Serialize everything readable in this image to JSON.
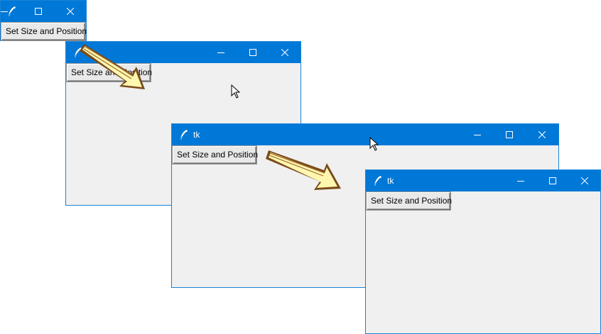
{
  "windows": [
    {
      "title": "",
      "button_label": "Set Size and Position"
    },
    {
      "title": "",
      "button_label": "Set Size and Position"
    },
    {
      "title": "tk",
      "button_label": "Set Size and Position"
    },
    {
      "title": "tk",
      "button_label": "Set Size and Position"
    }
  ],
  "icons": {
    "app": "feather-icon",
    "minimize": "minimize-icon",
    "maximize": "maximize-icon",
    "close": "close-icon",
    "cursor": "mouse-cursor-icon",
    "transition": "arrow-icon"
  },
  "colors": {
    "titlebar": "#0078d7",
    "window_bg": "#f0f0f0",
    "arrow_fill": "#fdf7b0",
    "arrow_outline": "#7a4a1a"
  }
}
